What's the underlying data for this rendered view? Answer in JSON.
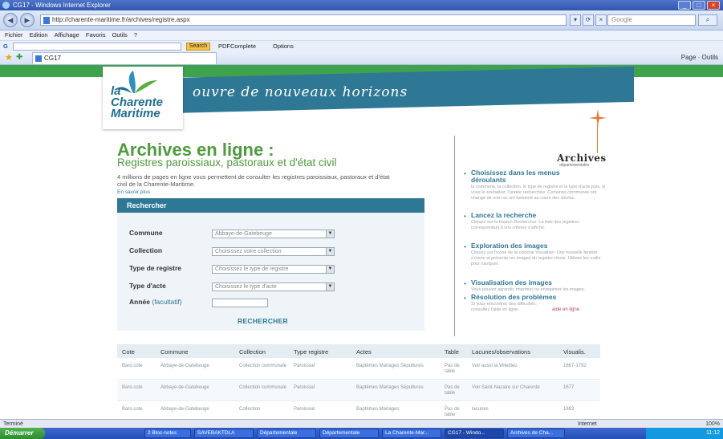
{
  "browser": {
    "window_title": "CG17 - Windows Internet Explorer",
    "url": "http://charente-maritime.fr/archives/registre.aspx",
    "search_placeholder": "Google",
    "menu": [
      "Fichier",
      "Edition",
      "Affichage",
      "Favoris",
      "Outils",
      "?"
    ],
    "toolbar_search_label": "Search",
    "toolbar_item": "PDFComplete",
    "toolbar_options": "Options",
    "tab_title": "CG17",
    "tools_text": "Page · Outils"
  },
  "site": {
    "logo_text": "la\nCharente\nMaritime",
    "slogan": "ouvre de nouveaux horizons"
  },
  "main": {
    "title": "Archives en ligne :",
    "subtitle": "Registres paroissiaux, pastoraux et d'état civil",
    "intro": "4 millions de pages en ligne vous permettent de consulter les registres paroissiaux, pastoraux et d'état civil de la Charente-Maritime.",
    "intro_link": "En savoir plus"
  },
  "search": {
    "header": "Rechercher",
    "fields": [
      {
        "label": "Commune",
        "value": "Abbaye-de-Gatebeuge"
      },
      {
        "label": "Collection",
        "value": "Choisissez votre collection"
      },
      {
        "label": "Type de registre",
        "value": "Choisissez le type de registre"
      },
      {
        "label": "Type d'acte",
        "value": "Choisissez le type d'acte"
      }
    ],
    "year_label": "Année",
    "year_sub": "(facultatif)",
    "button": "RECHERCHER"
  },
  "sidebar": {
    "logo": "Archives",
    "logo_sub": "départementales",
    "steps": [
      {
        "title": "Choisissez dans les menus déroulants",
        "text": "la commune, la collection, le type de registre et le type d'acte puis, si vous le souhaitez, l'année recherchée. Certaines communes ont changé de nom ou ont fusionné au cours des siècles."
      },
      {
        "title": "Lancez la recherche",
        "text": "Cliquez sur le bouton Rechercher. La liste des registres correspondant à vos critères s'affiche."
      },
      {
        "title": "Exploration des images",
        "text": "Cliquez sur l'icône de la colonne Visualiser. Une nouvelle fenêtre s'ouvre et présente les images du registre choisi. Utilisez les outils pour naviguer."
      },
      {
        "title": "Visualisation des images",
        "text": "Vous pouvez agrandir, imprimer ou enregistrer les images."
      },
      {
        "title": "Résolution des problèmes",
        "text": "Si vous rencontrez des difficultés, consultez l'aide en ligne.",
        "link": "aide en ligne"
      }
    ]
  },
  "results": {
    "headers": [
      "Cote",
      "Commune",
      "Collection",
      "Type registre",
      "Actes",
      "Table",
      "Lacunes/observations",
      "Visualis."
    ],
    "rows": [
      [
        "Baro.cote",
        "Abbaye-de-Gatebeuge",
        "Collection communale",
        "Paroissial",
        "Baptêmes Mariages Sépultures",
        "Pas de table",
        "Voir aussi la Villedieu",
        "1667-1792"
      ],
      [
        "Baro.cote",
        "Abbaye-de-Gatebeuge",
        "Collection communale",
        "Paroissial",
        "Baptêmes Mariages Sépultures",
        "Pas de table",
        "Voir Saint-Nazaire sur Charente",
        "1677"
      ],
      [
        "Baro.cote",
        "Abbaye-de-Gatebeuge",
        "Collection",
        "Paroissial",
        "Baptêmes Mariages",
        "Pas de table",
        "lacunes",
        "1693"
      ]
    ]
  },
  "status": {
    "left": "Terminé",
    "zone": "Internet",
    "zoom": "100%"
  },
  "taskbar": {
    "start": "Démarrer",
    "tasks": [
      "2 Bloc-notes",
      "SAVEBAKTDLA",
      "Départementale",
      "Départementale",
      "La Charente-Mar...",
      "CG17 - Windo...",
      "Archives de Cha..."
    ],
    "clock": "11:12"
  },
  "colors": {
    "brand_green": "#4f9b3d",
    "brand_blue": "#2e7896",
    "accent_orange": "#e37933"
  }
}
